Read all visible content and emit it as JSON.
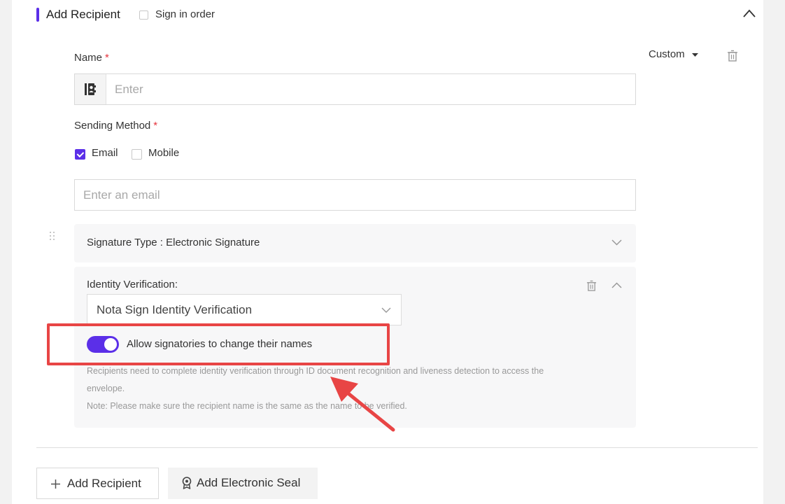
{
  "header": {
    "title": "Add Recipient",
    "sign_in_order_label": "Sign in order",
    "sign_in_order_checked": false
  },
  "recipient": {
    "role_select": "Custom",
    "name": {
      "label": "Name",
      "required_mark": "*",
      "placeholder": "Enter",
      "icon": "contacts-book-icon"
    },
    "sending_method": {
      "label": "Sending Method",
      "required_mark": "*",
      "options": [
        {
          "label": "Email",
          "checked": true
        },
        {
          "label": "Mobile",
          "checked": false
        }
      ],
      "email_placeholder": "Enter an email"
    },
    "signature_type": {
      "label": "Signature Type : Electronic Signature"
    },
    "identity_verification": {
      "label": "Identity Verification:",
      "selected": "Nota Sign Identity Verification",
      "toggle_label": "Allow signatories to change their names",
      "toggle_on": true,
      "help_line1": "Recipients need to complete identity verification through ID document recognition and liveness detection to access the",
      "help_line2": "envelope.",
      "note": "Note: Please make sure the recipient name is the same as the name to be verified."
    }
  },
  "footer": {
    "add_recipient_label": "Add Recipient",
    "add_seal_label": "Add Electronic Seal"
  },
  "colors": {
    "accent": "#5b2fe8",
    "required": "#e5343d",
    "highlight": "#e84545"
  }
}
